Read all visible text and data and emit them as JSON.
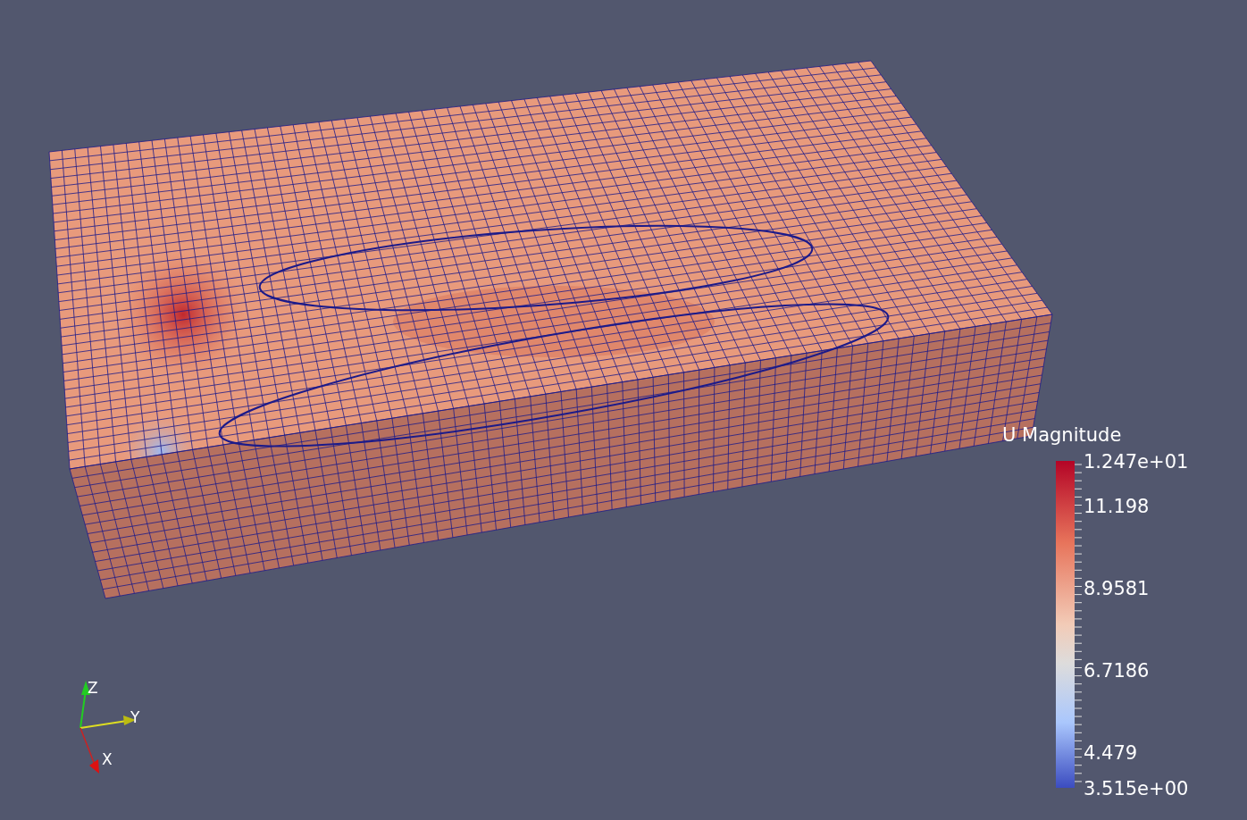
{
  "color_legend": {
    "title": "U Magnitude",
    "labels": [
      "1.247e+01",
      "11.198",
      "8.9581",
      "6.7186",
      "4.479",
      "3.515e+00"
    ]
  },
  "orientation_axes": {
    "labels": [
      "Z",
      "Y",
      "X"
    ]
  }
}
